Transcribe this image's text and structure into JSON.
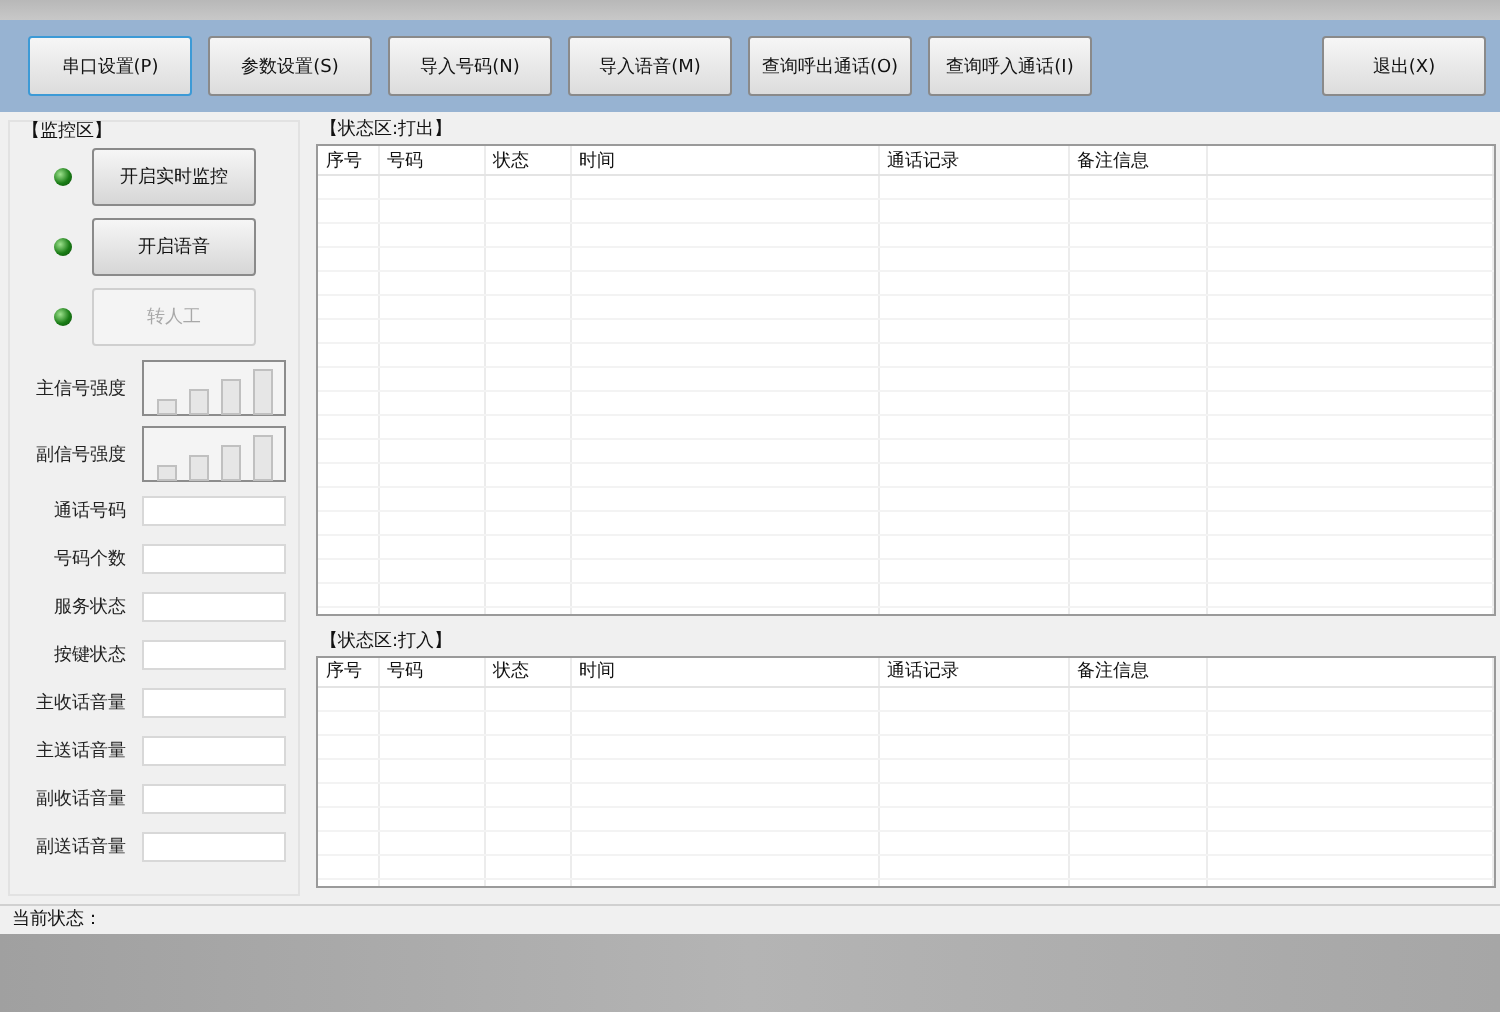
{
  "toolbar": [
    {
      "label": "串口设置(P)",
      "focused": true
    },
    {
      "label": "参数设置(S)",
      "focused": false
    },
    {
      "label": "导入号码(N)",
      "focused": false
    },
    {
      "label": "导入语音(M)",
      "focused": false
    },
    {
      "label": "查询呼出通话(O)",
      "focused": false
    },
    {
      "label": "查询呼入通话(I)",
      "focused": false
    },
    {
      "label": "退出(X)",
      "focused": false,
      "kind": "right"
    }
  ],
  "monitor": {
    "title": "【监控区】",
    "controls": [
      {
        "label": "开启实时监控",
        "disabled": false,
        "lit": true
      },
      {
        "label": "开启语音",
        "disabled": false,
        "lit": true
      },
      {
        "label": "转人工",
        "disabled": true,
        "lit": true
      }
    ],
    "signals": [
      {
        "label": "主信号强度"
      },
      {
        "label": "副信号强度"
      }
    ],
    "fields": [
      {
        "label": "通话号码"
      },
      {
        "label": "号码个数"
      },
      {
        "label": "服务状态"
      },
      {
        "label": "按键状态"
      },
      {
        "label": "主收话音量"
      },
      {
        "label": "主送话音量"
      },
      {
        "label": "副收话音量"
      },
      {
        "label": "副送话音量"
      }
    ]
  },
  "tables": [
    {
      "title": "【状态区:打出】",
      "columns": [
        "序号",
        "号码",
        "状态",
        "时间",
        "通话记录",
        "备注信息"
      ]
    },
    {
      "title": "【状态区:打入】",
      "columns": [
        "序号",
        "号码",
        "状态",
        "时间",
        "通话记录",
        "备注信息"
      ]
    }
  ],
  "status_bar": {
    "label": "当前状态："
  }
}
